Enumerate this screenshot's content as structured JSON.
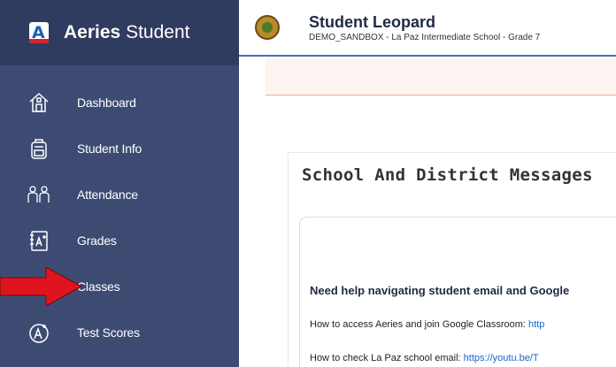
{
  "brand": {
    "name_bold": "Aeries",
    "name_light": "Student"
  },
  "sidebar": {
    "items": [
      {
        "label": "Dashboard",
        "icon": "home-icon"
      },
      {
        "label": "Student Info",
        "icon": "backpack-icon"
      },
      {
        "label": "Attendance",
        "icon": "people-icon"
      },
      {
        "label": "Grades",
        "icon": "gradebook-icon"
      },
      {
        "label": "Classes",
        "icon": "classes-icon"
      },
      {
        "label": "Test Scores",
        "icon": "test-scores-icon"
      }
    ]
  },
  "header": {
    "student_name": "Student Leopard",
    "student_sub": "DEMO_SANDBOX - La Paz Intermediate School - Grade 7"
  },
  "main": {
    "section_title": "School And District Messages",
    "msg_heading": "Need help navigating student email and Google",
    "line1_text": "How to access Aeries and join Google Classroom: ",
    "line1_link": "http",
    "line2_text": "How to check La Paz school email: ",
    "line2_link": "https://youtu.be/T"
  },
  "colors": {
    "sidebar": "#3d4b73",
    "brand_bar": "#2f3b5f",
    "accent": "#3e6fb8",
    "arrow": "#e0141e"
  }
}
